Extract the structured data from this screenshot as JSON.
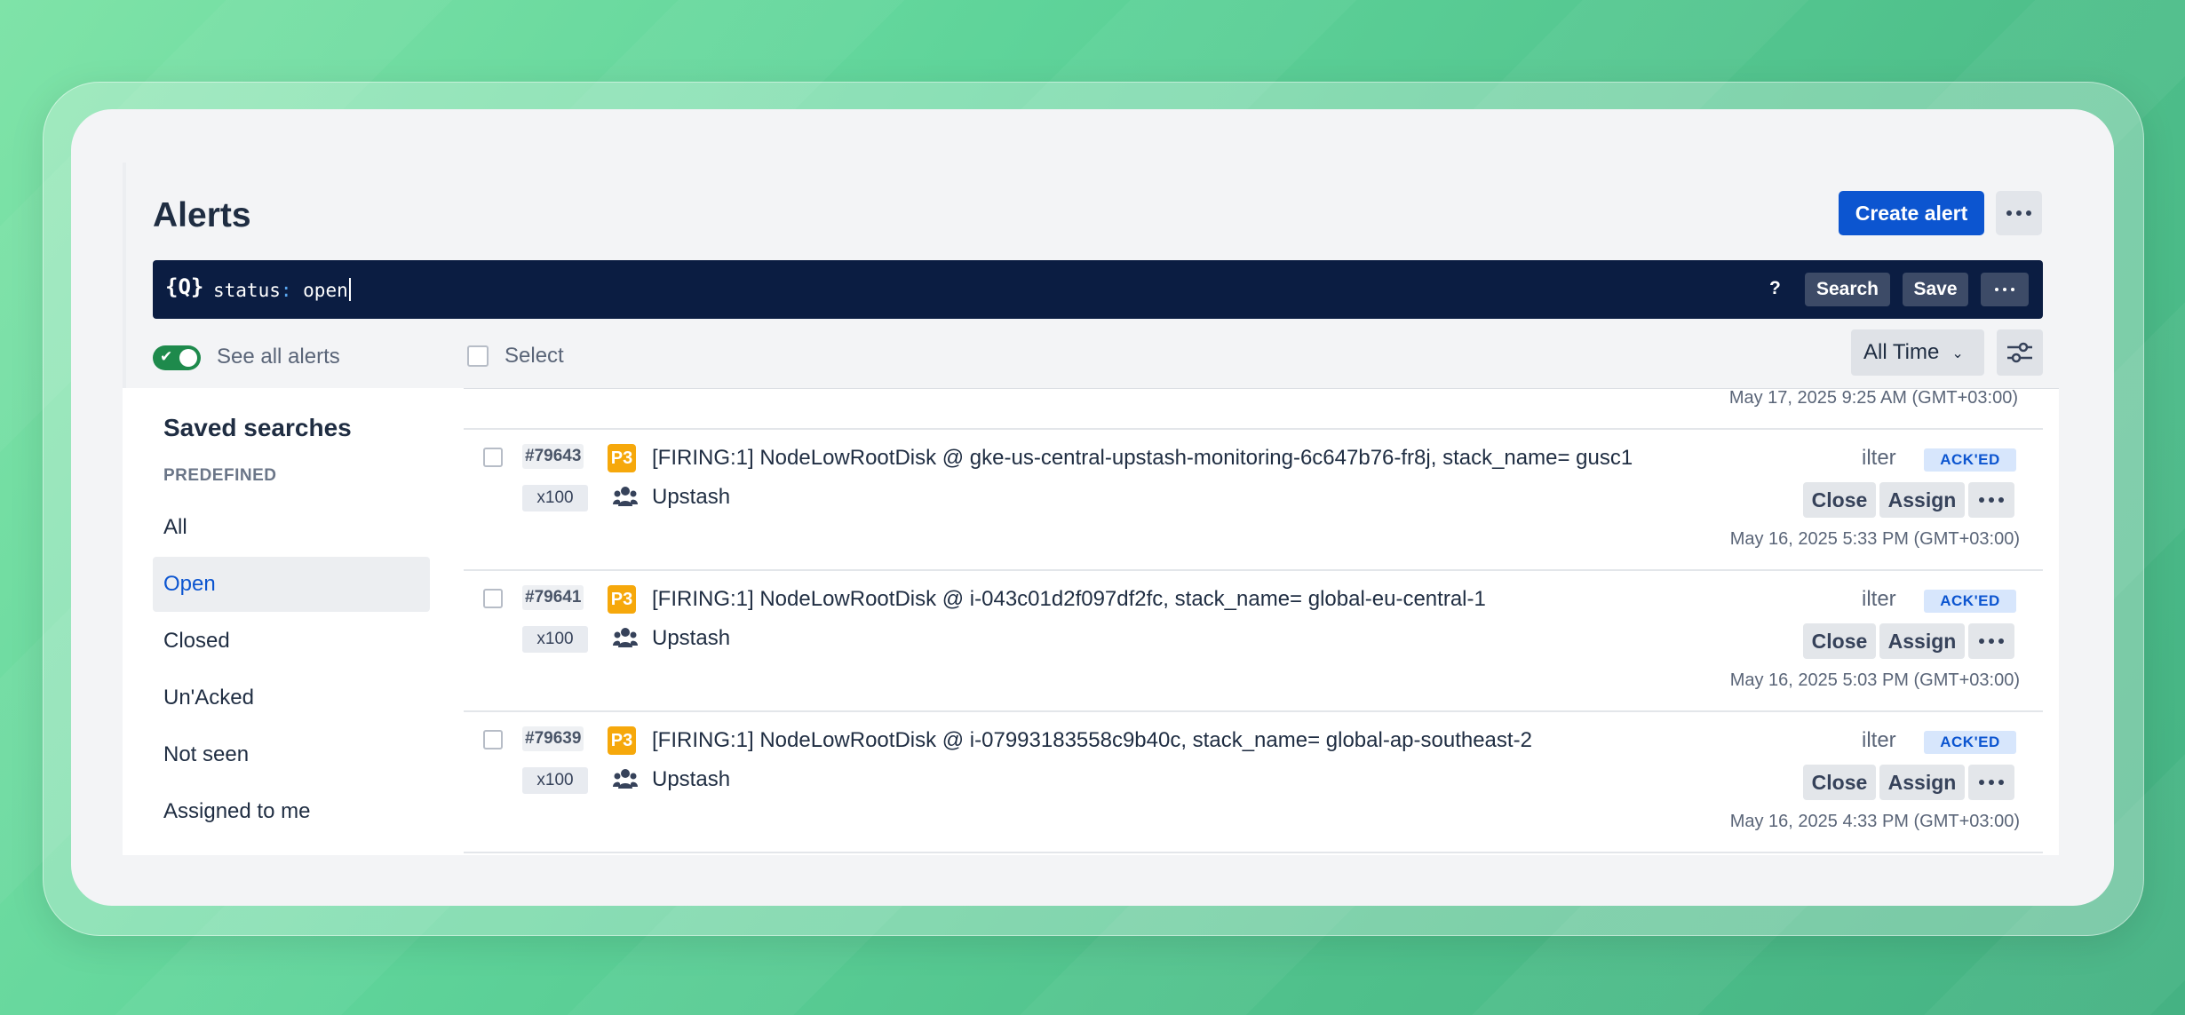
{
  "header": {
    "title": "Alerts",
    "create_button": "Create alert"
  },
  "search": {
    "icon_text": "{Q}",
    "query_key": "status",
    "query_colon": ":",
    "query_value": " open",
    "help": "?",
    "search_button": "Search",
    "save_button": "Save"
  },
  "toolbar": {
    "see_all_label": "See all alerts",
    "see_all_on": true,
    "select_label": "Select",
    "time_filter": "All Time"
  },
  "sidebar": {
    "title": "Saved searches",
    "section": "PREDEFINED",
    "items": [
      "All",
      "Open",
      "Closed",
      "Un'Acked",
      "Not seen",
      "Assigned to me"
    ],
    "active_item": "Open"
  },
  "list": {
    "top_timestamp": "May 17, 2025 9:25 AM (GMT+03:00)",
    "alerts": [
      {
        "id": "#79643",
        "count": "x100",
        "priority": "P3",
        "title": "[FIRING:1] NodeLowRootDisk @ gke-us-central-upstash-monitoring-6c647b76-fr8j, stack_name= gusc1",
        "team": "Upstash",
        "owner": "ilter",
        "status": "ACK'ED",
        "close": "Close",
        "assign": "Assign",
        "timestamp": "May 16, 2025 5:33 PM (GMT+03:00)"
      },
      {
        "id": "#79641",
        "count": "x100",
        "priority": "P3",
        "title": "[FIRING:1] NodeLowRootDisk @ i-043c01d2f097df2fc, stack_name= global-eu-central-1",
        "team": "Upstash",
        "owner": "ilter",
        "status": "ACK'ED",
        "close": "Close",
        "assign": "Assign",
        "timestamp": "May 16, 2025 5:03 PM (GMT+03:00)"
      },
      {
        "id": "#79639",
        "count": "x100",
        "priority": "P3",
        "title": "[FIRING:1] NodeLowRootDisk @ i-07993183558c9b40c, stack_name= global-ap-southeast-2",
        "team": "Upstash",
        "owner": "ilter",
        "status": "ACK'ED",
        "close": "Close",
        "assign": "Assign",
        "timestamp": "May 16, 2025 4:33 PM (GMT+03:00)"
      }
    ]
  },
  "colors": {
    "primary": "#0c55d0",
    "search_bg": "#0b1d42",
    "priority_p3": "#f6a80b",
    "toggle_on": "#1e8a4c",
    "badge_bg": "#d7e6fc"
  },
  "icons": {
    "search": "search-query-icon",
    "more": "ellipsis-icon",
    "filter": "sliders-icon",
    "team": "team-icon",
    "chevron": "chevron-down-icon"
  }
}
